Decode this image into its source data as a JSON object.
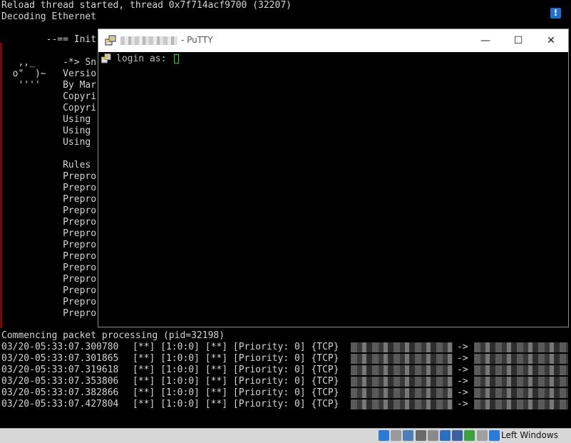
{
  "terminal": {
    "top_lines": [
      "Reload thread started, thread 0x7f714acf9700 (32207)",
      "Decoding Ethernet",
      "",
      "        --== Init",
      "",
      "   ,,_     -*> Sn",
      "  o\"  )~   Versio",
      "   ''''    By Mar",
      "           Copyri",
      "           Copyri",
      "           Using ",
      "           Using ",
      "           Using ",
      "",
      "           Rules ",
      "           Prepro",
      "           Prepro",
      "           Prepro",
      "           Prepro",
      "           Prepro",
      "           Prepro",
      "           Prepro",
      "           Prepro",
      "           Prepro",
      "           Prepro",
      "           Prepro",
      "           Prepro",
      "           Prepro"
    ],
    "commencing": "Commencing packet processing (pid=32198)",
    "alert_mid": "[**] [1:0:0] [**] [Priority: 0] {TCP}",
    "arrow": "->",
    "alerts": [
      {
        "time": "03/20-05:33:07.300780"
      },
      {
        "time": "03/20-05:33:07.301865"
      },
      {
        "time": "03/20-05:33:07.319618"
      },
      {
        "time": "03/20-05:33:07.353806"
      },
      {
        "time": "03/20-05:33:07.382866"
      },
      {
        "time": "03/20-05:33:07.427804"
      }
    ]
  },
  "putty": {
    "title": "- PuTTY",
    "prompt": "login as: ",
    "minimize": "—",
    "maximize": "☐",
    "close": "✕"
  },
  "taskbar": {
    "host_key_label": "Left Windows",
    "tray_icons": [
      "network-icon",
      "optical-drive-icon",
      "usb-icon",
      "display-icon",
      "shared-folder-icon",
      "monitor-icon",
      "video-capture-icon",
      "cpu-icon",
      "mouse-integration-icon",
      "download-icon"
    ]
  },
  "colors": {
    "terminal_text": "#d4d4d4",
    "cursor": "#1edc1e",
    "taskbar": "#d7d7d7"
  }
}
